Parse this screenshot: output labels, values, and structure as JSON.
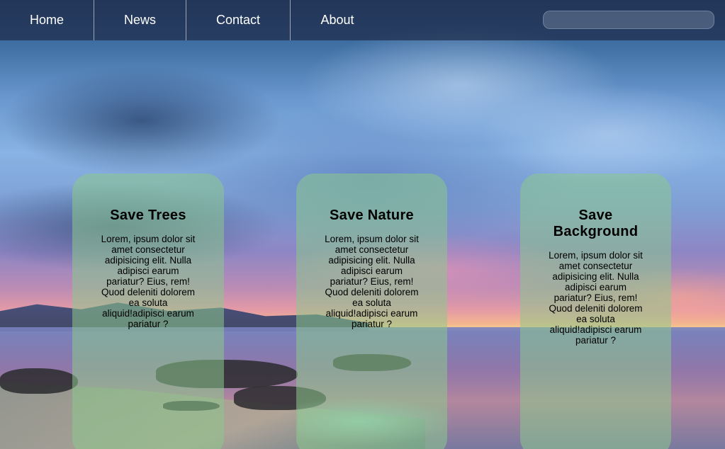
{
  "nav": {
    "items": [
      {
        "label": "Home"
      },
      {
        "label": "News"
      },
      {
        "label": "Contact"
      },
      {
        "label": "About"
      }
    ],
    "search": {
      "value": "",
      "placeholder": ""
    }
  },
  "cards": [
    {
      "title": "Save Trees",
      "text": "Lorem, ipsum dolor sit amet consectetur adipisicing elit. Nulla adipisci earum pariatur? Eius, rem! Quod deleniti dolorem ea soluta aliquid!adipisci earum pariatur ?"
    },
    {
      "title": "Save Nature",
      "text": "Lorem, ipsum dolor sit amet consectetur adipisicing elit. Nulla adipisci earum pariatur? Eius, rem! Quod deleniti dolorem ea soluta aliquid!adipisci earum pariatur ?"
    },
    {
      "title": "Save Background",
      "text": "Lorem, ipsum dolor sit amet consectetur adipisicing elit. Nulla adipisci earum pariatur? Eius, rem! Quod deleniti dolorem ea soluta aliquid!adipisci earum pariatur ?"
    }
  ],
  "colors": {
    "nav_background": "#1e2d4b",
    "card_background": "#8cc88c",
    "nav_text": "#ffffff"
  }
}
